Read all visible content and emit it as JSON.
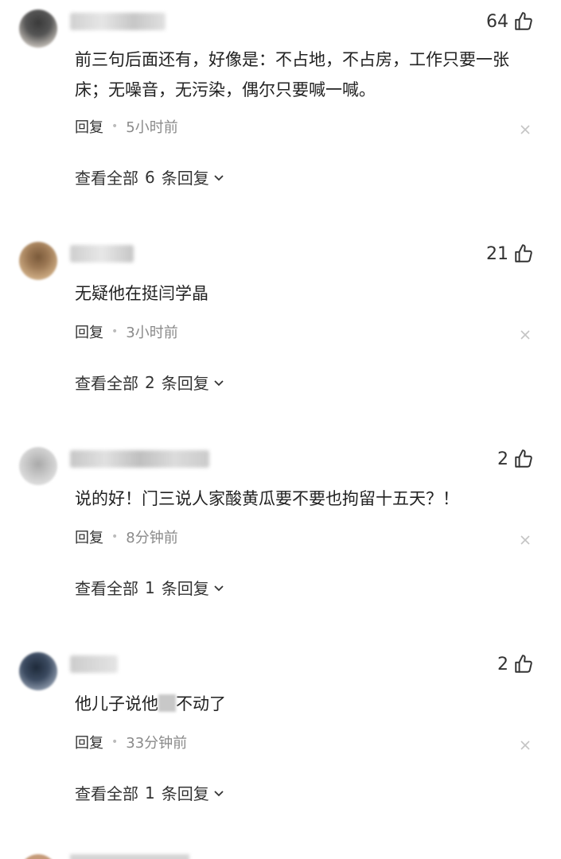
{
  "ui": {
    "reply_label": "回复",
    "view_all_prefix": "查看全部",
    "view_all_suffix": "条回复",
    "like_icon": "thumb-up-outline-icon",
    "close_icon": "close-x-icon",
    "expand_icon": "chevron-down-icon"
  },
  "comments": [
    {
      "likes": "64",
      "text": "前三句后面还有，好像是：不占地，不占房，工作只要一张床；无噪音，无污染，偶尔只要喊一喊。",
      "time": "5小时前",
      "reply_count": "6"
    },
    {
      "likes": "21",
      "text": "无疑他在挺闫学晶",
      "time": "3小时前",
      "reply_count": "2"
    },
    {
      "likes": "2",
      "text": "说的好！门三说人家酸黄瓜要不要也拘留十五天？！",
      "time": "8分钟前",
      "reply_count": "1"
    },
    {
      "likes": "2",
      "text_before": "他儿子说他",
      "text_after": "不动了",
      "time": "33分钟前",
      "reply_count": "1"
    }
  ]
}
